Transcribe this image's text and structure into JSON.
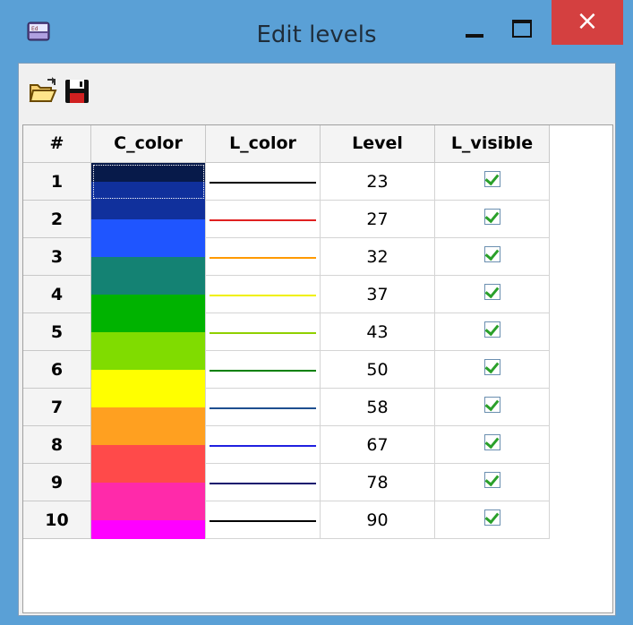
{
  "window": {
    "title": "Edit levels",
    "icon_name": "app-icon",
    "minimize_icon": "minimize-icon",
    "maximize_icon": "maximize-icon",
    "close_label": "×"
  },
  "toolbar": {
    "open_icon": "folder-open-icon",
    "save_icon": "floppy-disk-icon"
  },
  "table": {
    "columns": [
      "#",
      "C_color",
      "L_color",
      "Level",
      "L_visible"
    ],
    "rows": [
      {
        "num": "1",
        "c_color": "#071a4a",
        "l_color": "#000000",
        "level": "23",
        "visible": true
      },
      {
        "num": "2",
        "c_color": "#10309c",
        "l_color": "#e02020",
        "level": "27",
        "visible": true
      },
      {
        "num": "3",
        "c_color": "#1f55ff",
        "l_color": "#ff9900",
        "level": "32",
        "visible": true
      },
      {
        "num": "4",
        "c_color": "#148273",
        "l_color": "#f0f000",
        "level": "37",
        "visible": true
      },
      {
        "num": "5",
        "c_color": "#00b300",
        "l_color": "#90d000",
        "level": "43",
        "visible": true
      },
      {
        "num": "6",
        "c_color": "#80dc00",
        "l_color": "#008000",
        "level": "50",
        "visible": true
      },
      {
        "num": "7",
        "c_color": "#ffff00",
        "l_color": "#1e4f8f",
        "level": "58",
        "visible": true
      },
      {
        "num": "8",
        "c_color": "#ffa020",
        "l_color": "#2020e0",
        "level": "67",
        "visible": true
      },
      {
        "num": "9",
        "c_color": "#ff4a4a",
        "l_color": "#15156e",
        "level": "78",
        "visible": true
      },
      {
        "num": "10",
        "c_color": "#ff2aaa",
        "l_color": "#000000",
        "level": "90",
        "visible": true
      }
    ],
    "last_row_band_color": "#ff00ff"
  }
}
